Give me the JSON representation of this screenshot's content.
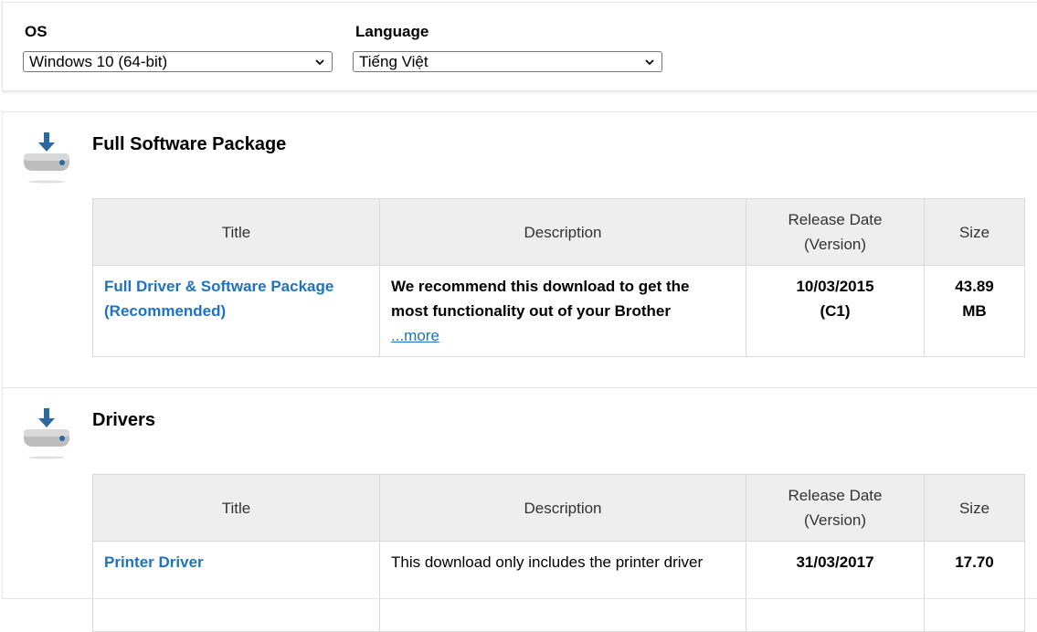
{
  "filters": {
    "os": {
      "label": "OS",
      "selected": "Windows 10 (64-bit)"
    },
    "language": {
      "label": "Language",
      "selected": "Tiếng Việt"
    }
  },
  "table_headers": {
    "title": "Title",
    "description": "Description",
    "release_date_line1": "Release Date",
    "release_date_line2": "(Version)",
    "size": "Size"
  },
  "sections": [
    {
      "title": "Full Software Package",
      "rows": [
        {
          "title_line1": "Full Driver & Software Package",
          "title_line2": "(Recommended)",
          "description_line1": "We recommend this download to get the",
          "description_line2": "most functionality out of your Brother",
          "more": "...more",
          "date": "10/03/2015",
          "version": "(C1)",
          "size_line1": "43.89",
          "size_line2": "MB"
        }
      ]
    },
    {
      "title": "Drivers",
      "rows": [
        {
          "title_line1": "Printer Driver",
          "description_line1": "This download only includes the printer driver",
          "date": "31/03/2017",
          "size_line1": "17.70"
        }
      ]
    }
  ],
  "icons": {
    "section_icon": "download-drive-icon",
    "dropdown": "chevron-down-icon"
  },
  "colors": {
    "link": "#1e73be",
    "header_bg": "#eeeeee",
    "icon_arrow": "#2b6aa0"
  }
}
